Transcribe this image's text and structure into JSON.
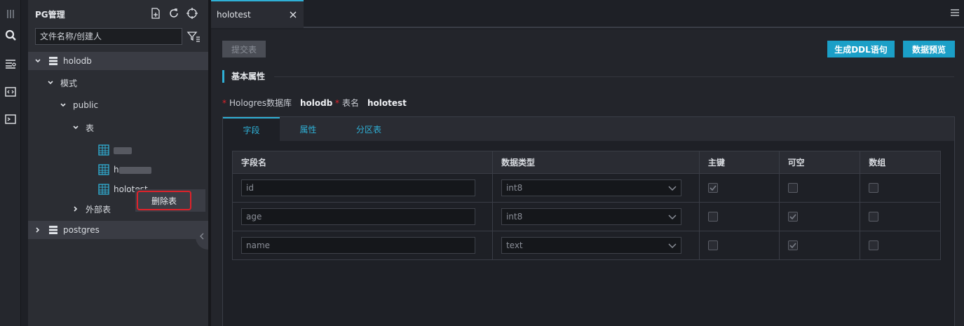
{
  "sidebar": {
    "title": "PG管理",
    "search_placeholder": "文件名称/创建人",
    "tree": {
      "holodb": "holodb",
      "schema_group": "模式",
      "public": "public",
      "tables_group": "表",
      "table1": "",
      "table2": "h",
      "table3": "holotest",
      "foreign_tables": "外部表",
      "postgres": "postgres"
    },
    "context_menu": {
      "delete_table": "删除表"
    }
  },
  "tabs": [
    {
      "label": "holotest"
    }
  ],
  "toolbar": {
    "submit_label": "提交表",
    "ddl_label": "生成DDL语句",
    "preview_label": "数据预览"
  },
  "section": {
    "title": "基本属性"
  },
  "props": {
    "db_label": "Hologres数据库",
    "db_value": "holodb",
    "table_label": "表名",
    "table_value": "holotest"
  },
  "panel_tabs": [
    "字段",
    "属性",
    "分区表"
  ],
  "columns_table": {
    "headers": [
      "字段名",
      "数据类型",
      "主键",
      "可空",
      "数组"
    ],
    "rows": [
      {
        "name": "id",
        "type": "int8",
        "primary": true,
        "nullable": false,
        "array": false
      },
      {
        "name": "age",
        "type": "int8",
        "primary": false,
        "nullable": true,
        "array": false
      },
      {
        "name": "name",
        "type": "text",
        "primary": false,
        "nullable": true,
        "array": false
      }
    ]
  },
  "colors": {
    "accent": "#2fb0d6",
    "primary_button": "#1b9fc7",
    "highlight_border": "#e0222a"
  }
}
